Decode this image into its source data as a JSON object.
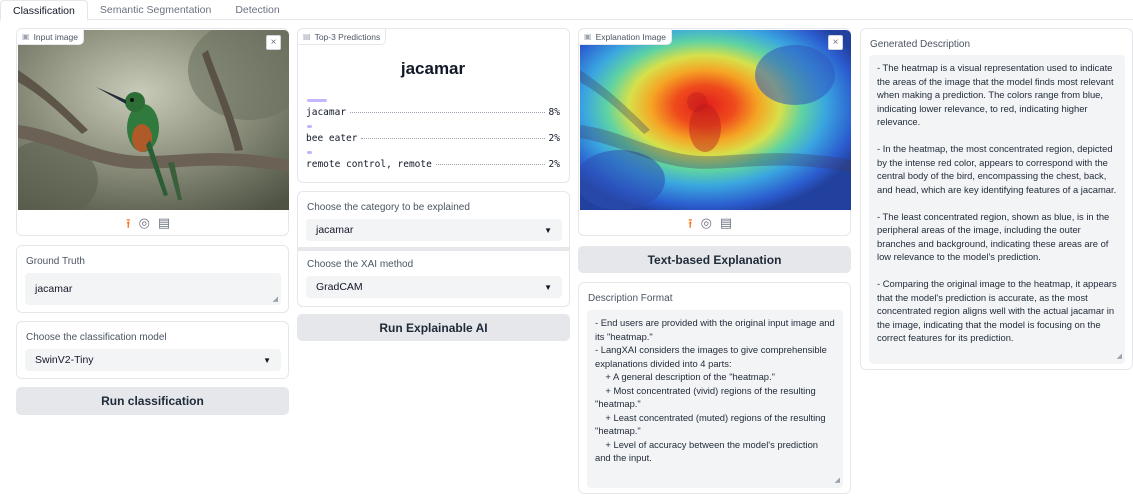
{
  "tabs": [
    "Classification",
    "Semantic Segmentation",
    "Detection"
  ],
  "input_panel": {
    "chip_label": "Input image",
    "close": "×",
    "tools": [
      "upload-icon",
      "webcam-icon",
      "clipboard-icon"
    ]
  },
  "ground_truth": {
    "label": "Ground Truth",
    "value": "jacamar"
  },
  "classification_model": {
    "label": "Choose the classification model",
    "selected": "SwinV2-Tiny"
  },
  "run_classification": {
    "label": "Run classification"
  },
  "predictions": {
    "chip_label": "Top-3 Predictions",
    "top_label": "jacamar",
    "items": [
      {
        "label": "jacamar",
        "percent": "8%",
        "confidence": 0.08
      },
      {
        "label": "bee eater",
        "percent": "2%",
        "confidence": 0.02
      },
      {
        "label": "remote control, remote",
        "percent": "2%",
        "confidence": 0.02
      }
    ]
  },
  "category": {
    "label": "Choose the category to be explained",
    "selected": "jacamar"
  },
  "xai_method": {
    "label": "Choose the XAI method",
    "selected": "GradCAM"
  },
  "run_xai": {
    "label": "Run Explainable AI"
  },
  "explanation_panel": {
    "chip_label": "Explanation Image",
    "close": "×"
  },
  "text_explanation": {
    "label": "Text-based Explanation"
  },
  "description_format": {
    "label": "Description Format",
    "text": "- End users are provided with the original input image and its \"heatmap.\"\n- LangXAI considers the images to give comprehensible explanations divided into 4 parts:\n    + A general description of the \"heatmap.\"\n    + Most concentrated (vivid) regions of the resulting \"heatmap.\"\n    + Least concentrated (muted) regions of the resulting \"heatmap.\"\n    + Level of accuracy between the model's prediction and the input."
  },
  "generated_description": {
    "label": "Generated Description",
    "text": "- The heatmap is a visual representation used to indicate the areas of the image that the model finds most relevant when making a prediction. The colors range from blue, indicating lower relevance, to red, indicating higher relevance.\n\n- In the heatmap, the most concentrated region, depicted by the intense red color, appears to correspond with the central body of the bird, encompassing the chest, back, and head, which are key identifying features of a jacamar.\n\n- The least concentrated region, shown as blue, is in the peripheral areas of the image, including the outer branches and background, indicating these areas are of low relevance to the model's prediction.\n\n- Comparing the original image to the heatmap, it appears that the model's prediction is accurate, as the most concentrated region aligns well with the actual jacamar in the image, indicating that the model is focusing on the correct features for its prediction."
  }
}
